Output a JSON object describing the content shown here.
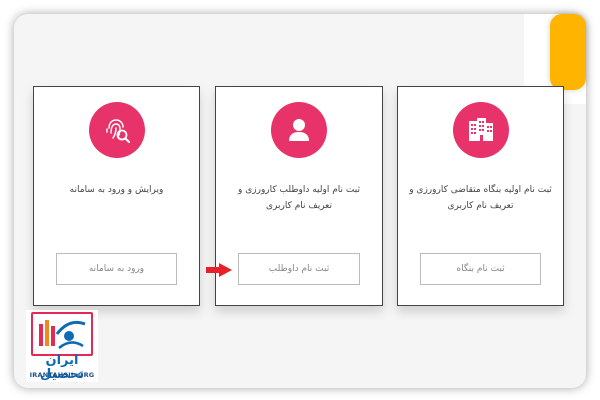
{
  "cards": [
    {
      "icon": "building-icon",
      "text": "ثبت نام اولیه بنگاه متقاضی کارورزی و تعریف نام کاربری",
      "button_label": "ثبت نام بنگاه"
    },
    {
      "icon": "user-icon",
      "text": "ثبت نام اولیه داوطلب کارورزی و تعریف نام کاربری",
      "button_label": "ثبت نام داوطلب"
    },
    {
      "icon": "fingerprint-icon",
      "text": "ویرایش و ورود به سامانه",
      "button_label": "ورود به سامانه"
    }
  ],
  "logo": {
    "title": "ایران تحصیل",
    "site": "IRANTAHSIL.ORG"
  },
  "colors": {
    "accent": "#e8336a",
    "badge": "#ffb400",
    "logo_blue": "#0f6ab4",
    "arrow": "#e8202a"
  }
}
